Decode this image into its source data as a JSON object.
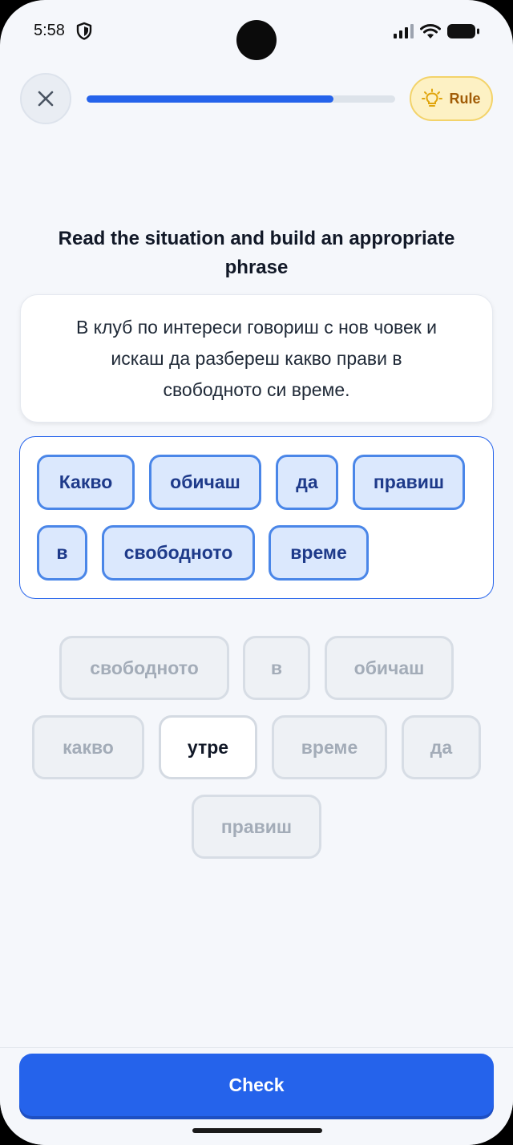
{
  "status_bar": {
    "time": "5:58"
  },
  "header": {
    "progress_fraction": 0.8,
    "rule_label": "Rule",
    "accent_color": "#2563eb"
  },
  "exercise": {
    "prompt": "Read the situation and build an appropriate phrase",
    "situation": "В клуб по интереси говориш с нов човек и искаш да разбереш какво прави в свободното си време."
  },
  "answer": {
    "chips": [
      "Какво",
      "обичаш",
      "да",
      "правиш",
      "в",
      "свободното",
      "време"
    ]
  },
  "word_bank": {
    "chips": [
      "свободното",
      "в",
      "обичаш",
      "какво",
      "утре",
      "време",
      "да",
      "правиш"
    ],
    "available": "утре"
  },
  "footer": {
    "check_label": "Check"
  },
  "icons": [
    "shield-icon",
    "signal-icon",
    "wifi-icon",
    "battery-icon",
    "close-icon",
    "lightbulb-icon"
  ]
}
